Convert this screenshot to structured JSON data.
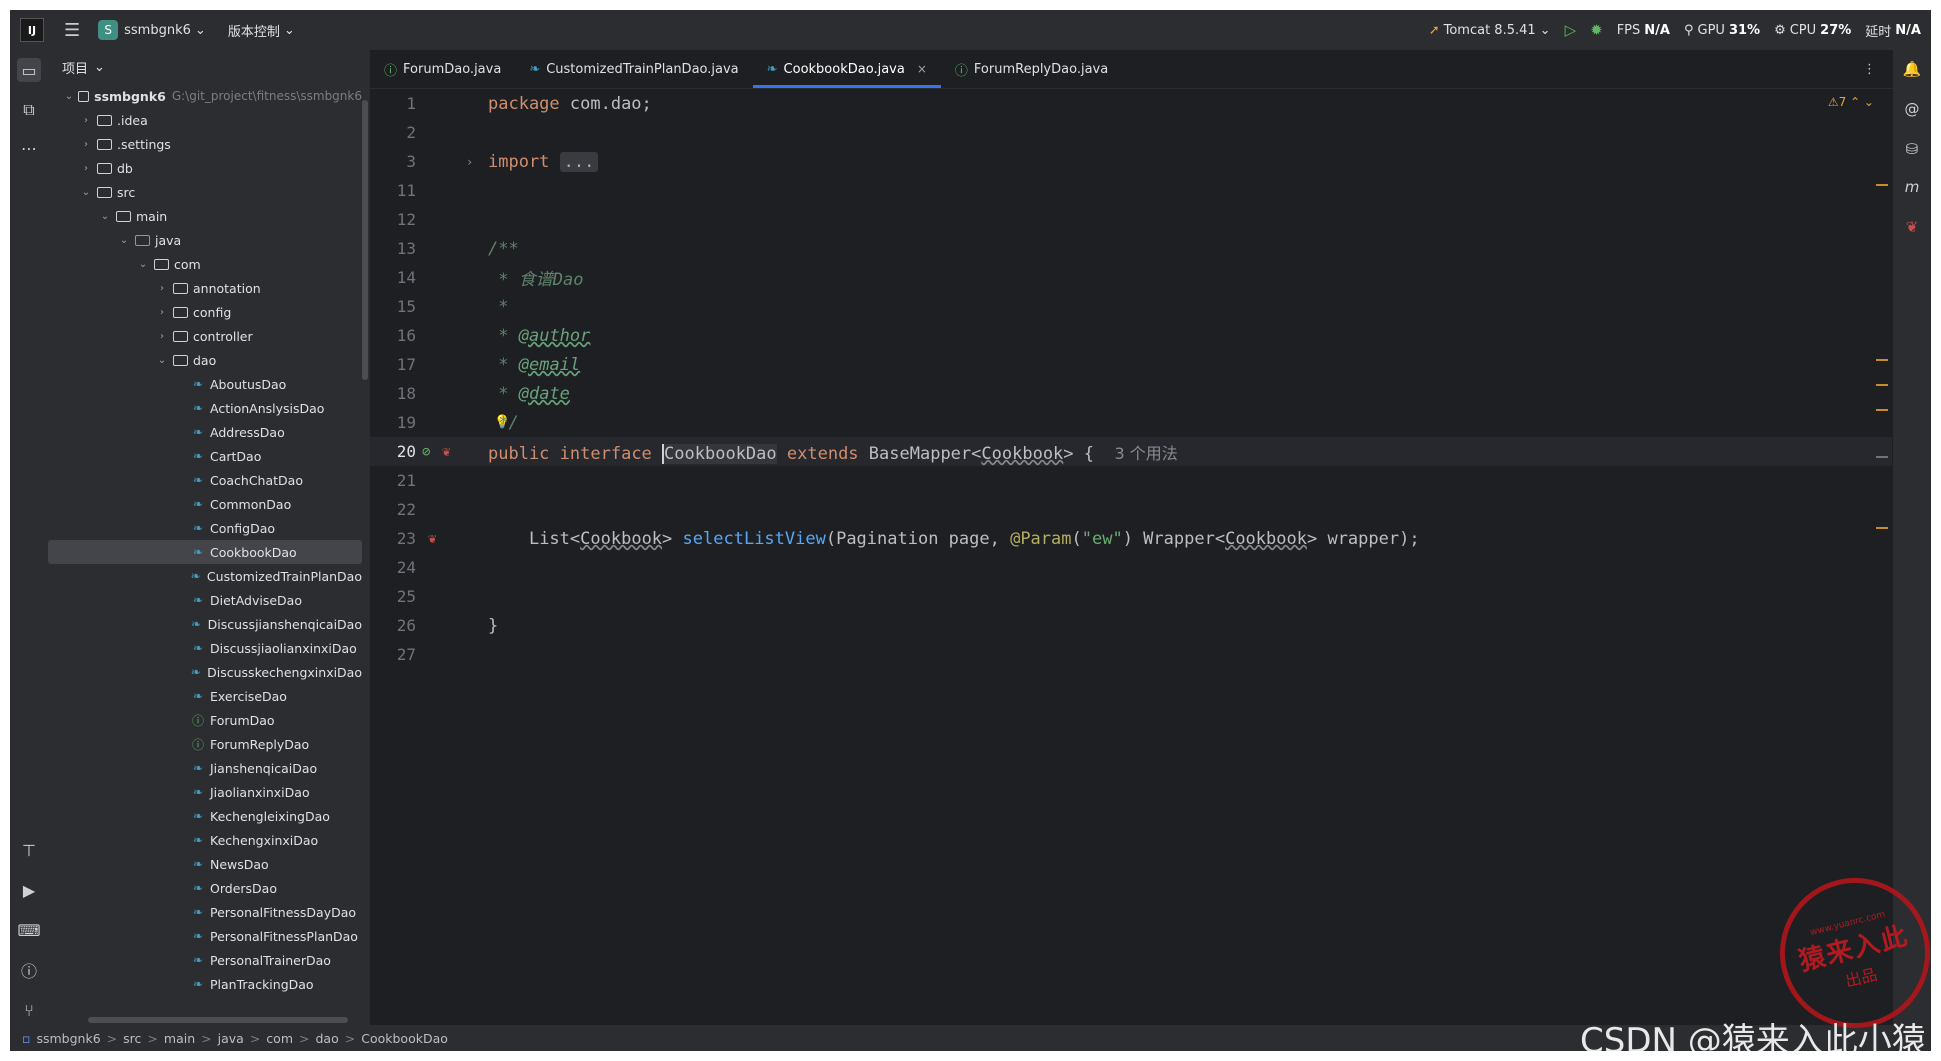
{
  "titlebar": {
    "app_logo": "IJ",
    "project_badge": "S",
    "project_name": "ssmbgnk6",
    "vcs_label": "版本控制",
    "run_config": "Tomcat 8.5.41",
    "fps_label": "FPS",
    "fps_value": "N/A",
    "gpu_label": "GPU",
    "gpu_value": "31%",
    "cpu_label": "CPU",
    "cpu_value": "27%",
    "time_label": "延时",
    "time_value": "N/A"
  },
  "project_panel": {
    "header": "项目",
    "root_name": "ssmbgnk6",
    "root_path": "G:\\git_project\\fitness\\ssmbgnk6",
    "items": [
      {
        "label": ".idea",
        "indent": 1,
        "type": "folder",
        "chevron": "right"
      },
      {
        "label": ".settings",
        "indent": 1,
        "type": "folder",
        "chevron": "right"
      },
      {
        "label": "db",
        "indent": 1,
        "type": "folder",
        "chevron": "right"
      },
      {
        "label": "src",
        "indent": 1,
        "type": "folder",
        "chevron": "down"
      },
      {
        "label": "main",
        "indent": 2,
        "type": "folder",
        "chevron": "down"
      },
      {
        "label": "java",
        "indent": 3,
        "type": "folder-blue",
        "chevron": "down"
      },
      {
        "label": "com",
        "indent": 4,
        "type": "package",
        "chevron": "down"
      },
      {
        "label": "annotation",
        "indent": 5,
        "type": "package",
        "chevron": "right"
      },
      {
        "label": "config",
        "indent": 5,
        "type": "package",
        "chevron": "right"
      },
      {
        "label": "controller",
        "indent": 5,
        "type": "package",
        "chevron": "right"
      },
      {
        "label": "dao",
        "indent": 5,
        "type": "package",
        "chevron": "down"
      },
      {
        "label": "AboutusDao",
        "indent": 6,
        "type": "class"
      },
      {
        "label": "ActionAnslysisDao",
        "indent": 6,
        "type": "class"
      },
      {
        "label": "AddressDao",
        "indent": 6,
        "type": "class"
      },
      {
        "label": "CartDao",
        "indent": 6,
        "type": "class"
      },
      {
        "label": "CoachChatDao",
        "indent": 6,
        "type": "class"
      },
      {
        "label": "CommonDao",
        "indent": 6,
        "type": "class"
      },
      {
        "label": "ConfigDao",
        "indent": 6,
        "type": "class"
      },
      {
        "label": "CookbookDao",
        "indent": 6,
        "type": "class",
        "selected": true
      },
      {
        "label": "CustomizedTrainPlanDao",
        "indent": 6,
        "type": "class"
      },
      {
        "label": "DietAdviseDao",
        "indent": 6,
        "type": "class"
      },
      {
        "label": "DiscussjianshenqicaiDao",
        "indent": 6,
        "type": "class"
      },
      {
        "label": "DiscussjiaolianxinxiDao",
        "indent": 6,
        "type": "class"
      },
      {
        "label": "DiscusskechengxinxiDao",
        "indent": 6,
        "type": "class"
      },
      {
        "label": "ExerciseDao",
        "indent": 6,
        "type": "class"
      },
      {
        "label": "ForumDao",
        "indent": 6,
        "type": "interface"
      },
      {
        "label": "ForumReplyDao",
        "indent": 6,
        "type": "interface"
      },
      {
        "label": "JianshenqicaiDao",
        "indent": 6,
        "type": "class"
      },
      {
        "label": "JiaolianxinxiDao",
        "indent": 6,
        "type": "class"
      },
      {
        "label": "KechengleixingDao",
        "indent": 6,
        "type": "class"
      },
      {
        "label": "KechengxinxiDao",
        "indent": 6,
        "type": "class"
      },
      {
        "label": "NewsDao",
        "indent": 6,
        "type": "class"
      },
      {
        "label": "OrdersDao",
        "indent": 6,
        "type": "class"
      },
      {
        "label": "PersonalFitnessDayDao",
        "indent": 6,
        "type": "class"
      },
      {
        "label": "PersonalFitnessPlanDao",
        "indent": 6,
        "type": "class"
      },
      {
        "label": "PersonalTrainerDao",
        "indent": 6,
        "type": "class"
      },
      {
        "label": "PlanTrackingDao",
        "indent": 6,
        "type": "class"
      }
    ]
  },
  "tabs": [
    {
      "label": "ForumDao.java",
      "icon": "interface-icon",
      "active": false
    },
    {
      "label": "CustomizedTrainPlanDao.java",
      "icon": "java-class-icon",
      "active": false
    },
    {
      "label": "CookbookDao.java",
      "icon": "java-class-icon",
      "active": true,
      "close": "×"
    },
    {
      "label": "ForumReplyDao.java",
      "icon": "interface-icon",
      "active": false
    }
  ],
  "editor": {
    "warnings_count": "7",
    "lines": {
      "l1": "1",
      "l2": "2",
      "l3": "3",
      "l11": "11",
      "l12": "12",
      "l13": "13",
      "l14": "14",
      "l15": "15",
      "l16": "16",
      "l17": "17",
      "l18": "18",
      "l19": "19",
      "l20": "20",
      "l21": "21",
      "l22": "22",
      "l23": "23",
      "l24": "24",
      "l25": "25",
      "l26": "26",
      "l27": "27"
    },
    "code": {
      "package_kw": "package",
      "package_name": " com.dao;",
      "import_kw": "import",
      "import_fold": "...",
      "doc_open": "/**",
      "doc_star": " *",
      "doc_title": " 食谱Dao",
      "tag_author": "@author",
      "tag_email": "@email",
      "tag_date": "@date",
      "doc_close": "*/",
      "public_kw": "public",
      "interface_kw": "interface",
      "class_name": "CookbookDao",
      "extends_kw": "extends",
      "base": "BaseMapper",
      "lt": "<",
      "generic": "Cookbook",
      "gt": ">",
      "brace_open": " {",
      "usages_hint": "3 个用法",
      "list": "List",
      "method": "selectListView",
      "params_1": "(Pagination page, ",
      "annotation": "@Param",
      "paren_open": "(",
      "ew": "\"ew\"",
      "params_2": ") Wrapper",
      "params_3": " wrapper);",
      "brace_close": "}"
    }
  },
  "statusbar": {
    "crumbs": [
      "ssmbgnk6",
      "src",
      "main",
      "java",
      "com",
      "dao",
      "CookbookDao"
    ],
    "separator": ">"
  },
  "watermark": {
    "stamp_url": "www.yuanrc.com",
    "stamp_main": "猿来入此",
    "stamp_sub": "出品",
    "csdn": "CSDN @猿来入此小猿"
  },
  "colors": {
    "background": "#1e1f22",
    "panel": "#2b2d30",
    "accent": "#3574f0",
    "keyword": "#cf8e6d",
    "function": "#56a8f5",
    "string": "#6aab73",
    "doc": "#5f826b"
  }
}
